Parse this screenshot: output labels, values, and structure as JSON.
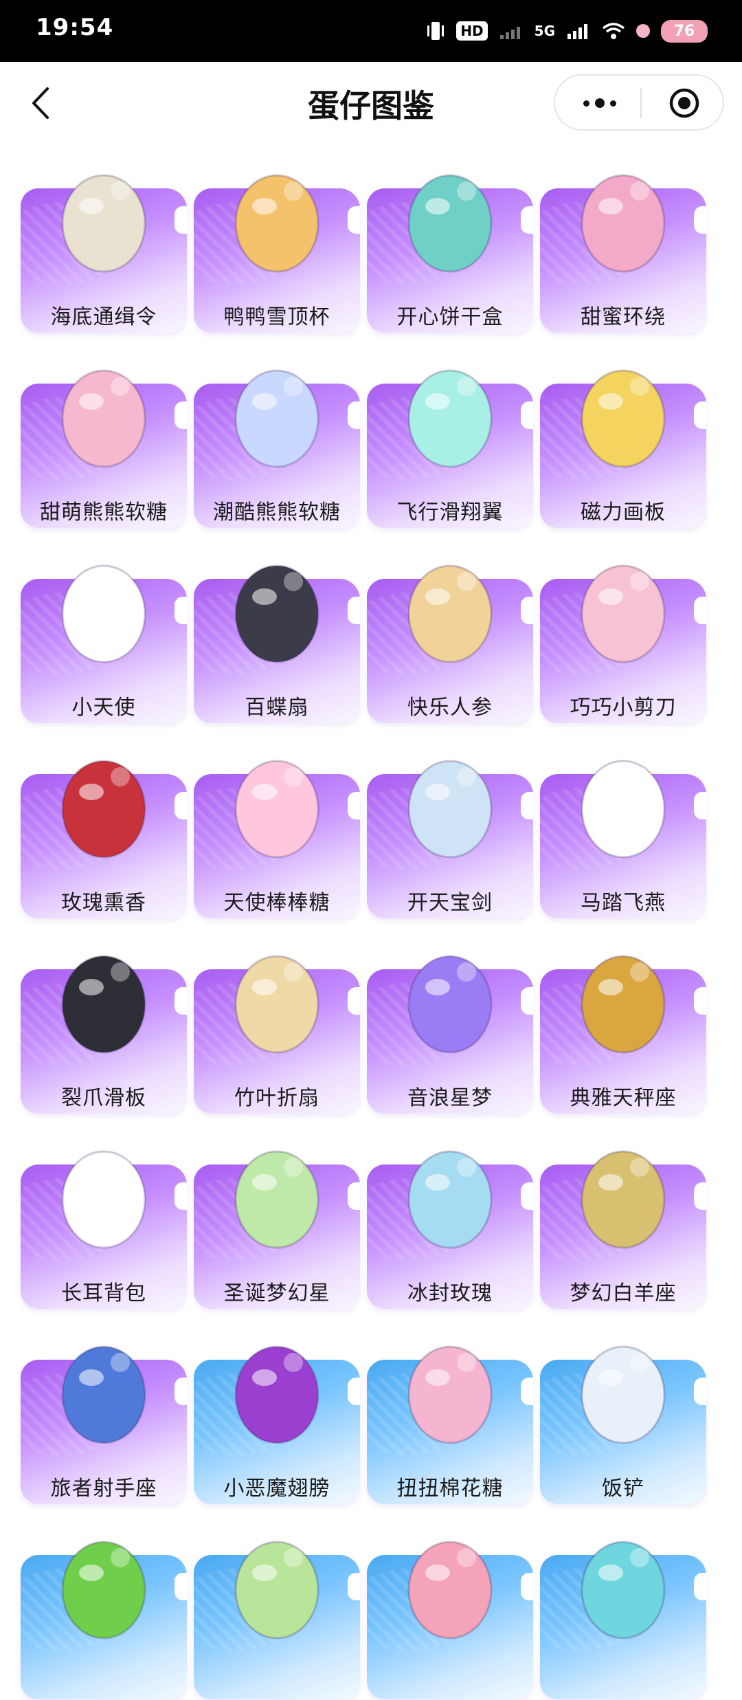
{
  "status_bar": {
    "time": "19:54",
    "hd": "HD",
    "network": "5G",
    "battery": "76"
  },
  "nav": {
    "title": "蛋仔图鉴"
  },
  "items": [
    {
      "name": "海底通缉令",
      "bg": "purple",
      "icon": "wanted-poster-icon",
      "color": "#e9e2d0"
    },
    {
      "name": "鸭鸭雪顶杯",
      "bg": "purple",
      "icon": "duck-ice-cream-cup-icon",
      "color": "#f4c26b"
    },
    {
      "name": "开心饼干盒",
      "bg": "purple",
      "icon": "cookie-box-icon",
      "color": "#6fd0c8"
    },
    {
      "name": "甜蜜环绕",
      "bg": "purple",
      "icon": "candy-wreath-icon",
      "color": "#f3a9c8"
    },
    {
      "name": "甜萌熊熊软糖",
      "bg": "purple",
      "icon": "pink-bear-gummy-icon",
      "color": "#f6b8cf"
    },
    {
      "name": "潮酷熊熊软糖",
      "bg": "purple",
      "icon": "cool-bear-gummy-icon",
      "color": "#c9d8ff"
    },
    {
      "name": "飞行滑翔翼",
      "bg": "purple",
      "icon": "glider-wings-icon",
      "color": "#a8f0e6"
    },
    {
      "name": "磁力画板",
      "bg": "purple",
      "icon": "drawing-board-icon",
      "color": "#f4d35e"
    },
    {
      "name": "小天使",
      "bg": "purple",
      "icon": "angel-wings-icon",
      "color": "#ffffff"
    },
    {
      "name": "百蝶扇",
      "bg": "purple",
      "icon": "butterfly-fan-icon",
      "color": "#3b3b4a"
    },
    {
      "name": "快乐人参",
      "bg": "purple",
      "icon": "ginseng-icon",
      "color": "#f1d39a"
    },
    {
      "name": "巧巧小剪刀",
      "bg": "purple",
      "icon": "scissors-icon",
      "color": "#f7c3d2"
    },
    {
      "name": "玫瑰熏香",
      "bg": "purple",
      "icon": "rose-incense-icon",
      "color": "#c8323a"
    },
    {
      "name": "天使棒棒糖",
      "bg": "purple",
      "icon": "angel-lollipop-icon",
      "color": "#ffc7de"
    },
    {
      "name": "开天宝剑",
      "bg": "purple",
      "icon": "sword-icon",
      "color": "#cfe3f6"
    },
    {
      "name": "马踏飞燕",
      "bg": "purple",
      "icon": "flying-horse-icon",
      "color": "#ffffff"
    },
    {
      "name": "裂爪滑板",
      "bg": "purple",
      "icon": "skateboard-icon",
      "color": "#2e2e36"
    },
    {
      "name": "竹叶折扇",
      "bg": "purple",
      "icon": "bamboo-fan-icon",
      "color": "#efd9a6"
    },
    {
      "name": "音浪星梦",
      "bg": "purple",
      "icon": "star-dream-wings-icon",
      "color": "#9a7cf4"
    },
    {
      "name": "典雅天秤座",
      "bg": "purple",
      "icon": "libra-scale-icon",
      "color": "#d9a640"
    },
    {
      "name": "长耳背包",
      "bg": "purple",
      "icon": "bunny-backpack-icon",
      "color": "#ffffff"
    },
    {
      "name": "圣诞梦幻星",
      "bg": "purple",
      "icon": "christmas-star-bottle-icon",
      "color": "#bfe9a8"
    },
    {
      "name": "冰封玫瑰",
      "bg": "purple",
      "icon": "frozen-rose-icon",
      "color": "#a6dcf2"
    },
    {
      "name": "梦幻白羊座",
      "bg": "purple",
      "icon": "aries-horns-icon",
      "color": "#d8c070"
    },
    {
      "name": "旅者射手座",
      "bg": "purple",
      "icon": "sagittarius-bow-icon",
      "color": "#4f7ad9"
    },
    {
      "name": "小恶魔翅膀",
      "bg": "blue",
      "icon": "devil-wings-icon",
      "color": "#9b3fd1"
    },
    {
      "name": "扭扭棉花糖",
      "bg": "blue",
      "icon": "twisted-marshmallow-icon",
      "color": "#f5b4d0"
    },
    {
      "name": "饭铲",
      "bg": "blue",
      "icon": "rice-spatula-icon",
      "color": "#e8f1fa"
    },
    {
      "name": "",
      "bg": "blue",
      "icon": "cactus-pot-icon",
      "color": "#6fcf4a"
    },
    {
      "name": "",
      "bg": "blue",
      "icon": "leek-icon",
      "color": "#b9e59a"
    },
    {
      "name": "",
      "bg": "blue",
      "icon": "syringe-icon",
      "color": "#f4a3b8"
    },
    {
      "name": "",
      "bg": "blue",
      "icon": "sand-bucket-icon",
      "color": "#6fd6e0"
    }
  ]
}
